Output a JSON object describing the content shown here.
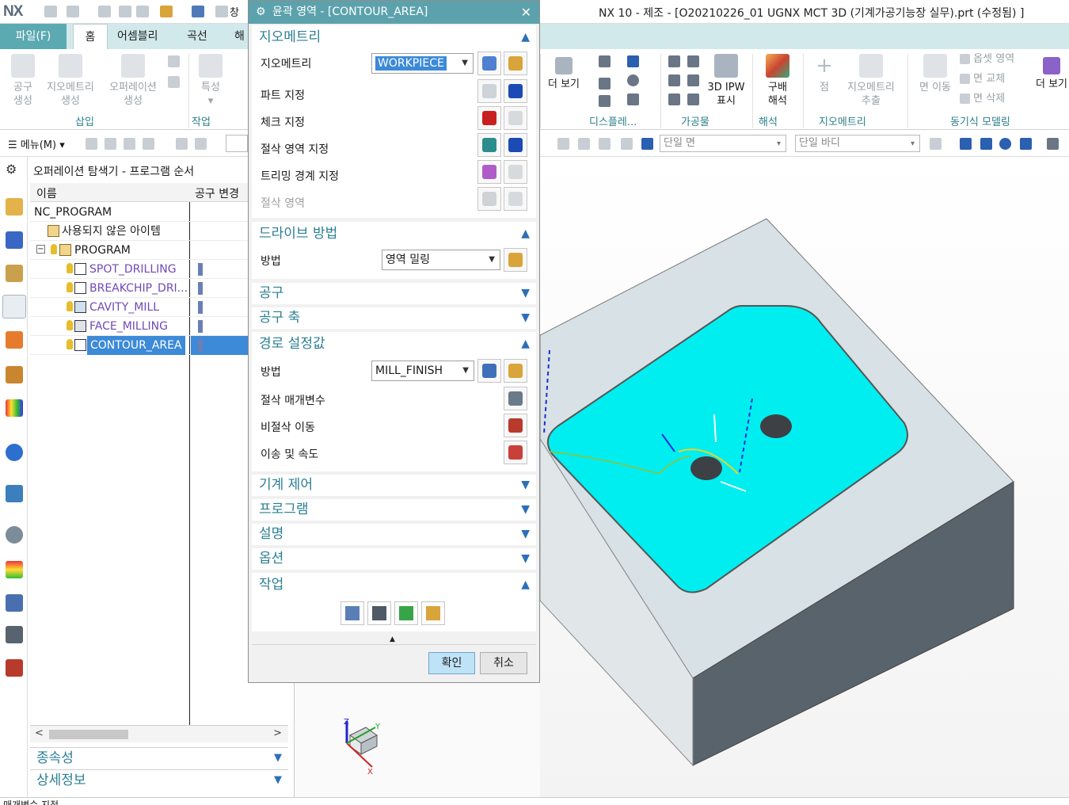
{
  "app": {
    "logo": "NX",
    "window_menu": "창",
    "title": "NX 10 - 제조 - [O20210226_01 UGNX MCT 3D (기계가공기능장 실무).prt (수정됨) ]"
  },
  "ribbon": {
    "tabs": [
      "파일(F)",
      "홈",
      "어셈블리",
      "곡선",
      "해"
    ],
    "active_tab": "홈",
    "buttons": {
      "tool_create": [
        "공구",
        "생성"
      ],
      "geometry_create": [
        "지오메트리",
        "생성"
      ],
      "operation_create": [
        "오퍼레이션",
        "생성"
      ],
      "properties": "특성",
      "more_view": "더 보기",
      "ipw_3d": [
        "3D IPW",
        "표시"
      ],
      "gouge_analysis": [
        "구배",
        "해석"
      ],
      "point": "점",
      "geometry_extract": [
        "지오메트리",
        "추출"
      ],
      "face_move": "면 이동",
      "offset_region": "옵셋 영역",
      "face_replace": "면 교체",
      "face_delete": "면 삭제",
      "more_view_right": "더 보기"
    },
    "groups": {
      "insert": "삽입",
      "work": "작업",
      "display": "디스플레...",
      "workpiece": "가공물",
      "analysis": "해석",
      "geometry": "지오메트리",
      "sync_modeling": "동기식 모델링"
    }
  },
  "toolbar2": {
    "menu": "메뉴(M)",
    "face_filter": "단일 면",
    "body_filter": "단일 바디"
  },
  "navigator": {
    "title": "오퍼레이션 탐색기 - 프로그램 순서",
    "columns": [
      "이름",
      "공구 변경"
    ],
    "rows": [
      {
        "label": "NC_PROGRAM",
        "indent": 0,
        "type": "root"
      },
      {
        "label": "사용되지 않은 아이템",
        "indent": 1,
        "type": "folder"
      },
      {
        "label": "PROGRAM",
        "indent": 1,
        "type": "folder"
      },
      {
        "label": "SPOT_DRILLING",
        "indent": 2,
        "type": "op"
      },
      {
        "label": "BREAKCHIP_DRI...",
        "indent": 2,
        "type": "op"
      },
      {
        "label": "CAVITY_MILL",
        "indent": 2,
        "type": "op"
      },
      {
        "label": "FACE_MILLING",
        "indent": 2,
        "type": "op"
      },
      {
        "label": "CONTOUR_AREA",
        "indent": 2,
        "type": "op",
        "selected": true
      }
    ],
    "sections": [
      "종속성",
      "상세정보"
    ]
  },
  "dialog": {
    "title": "윤곽 영역 - [CONTOUR_AREA]",
    "geometry": {
      "header": "지오메트리",
      "geometry_label": "지오메트리",
      "geometry_value": "WORKPIECE",
      "part": "파트 지정",
      "check": "체크 지정",
      "cut_area": "절삭 영역 지정",
      "trim_boundary": "트리밍 경계 지정",
      "cut_region": "절삭 영역"
    },
    "drive": {
      "header": "드라이브 방법",
      "method_label": "방법",
      "method_value": "영역 밀링"
    },
    "tool": "공구",
    "tool_axis": "공구 축",
    "path": {
      "header": "경로 설정값",
      "method_label": "방법",
      "method_value": "MILL_FINISH",
      "cut_params": "절삭 매개변수",
      "non_cut": "비절삭 이동",
      "feeds": "이송 및 속도"
    },
    "collapsed": [
      "기계 제어",
      "프로그램",
      "설명",
      "옵션"
    ],
    "actions_header": "작업",
    "ok": "확인",
    "cancel": "취소"
  },
  "triad": {
    "x": "X",
    "y": "Y",
    "z": "Z"
  },
  "status": "매개변수 지정",
  "colors": {
    "accent": "#5ca2ac",
    "selection": "#3c8ad8",
    "floor": "#00eef0",
    "block": "#d9e1e4"
  }
}
